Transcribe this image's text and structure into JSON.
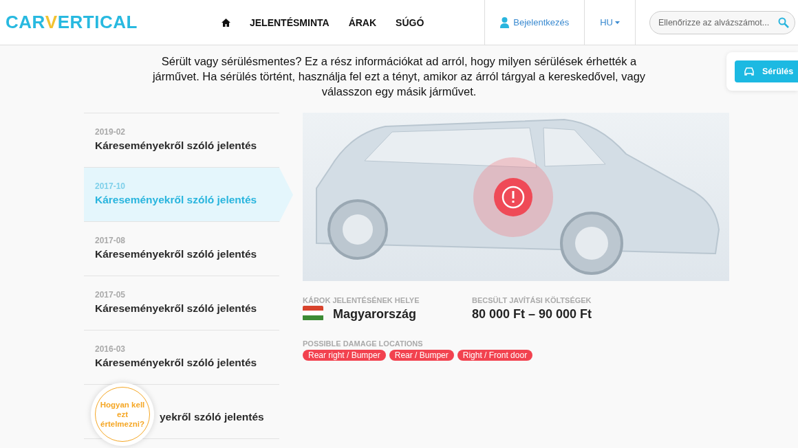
{
  "header": {
    "logo": {
      "part1": "CAR",
      "part2": "V",
      "part3": "ERTICAL"
    },
    "nav": [
      "JELENTÉSMINTA",
      "ÁRAK",
      "SÚGÓ"
    ],
    "login": "Bejelentkezés",
    "language": "HU",
    "search": {
      "placeholder": "Ellenőrizze az alvázszámot..."
    }
  },
  "side_tab": {
    "label": "Sérülés",
    "selected": true
  },
  "intro": "Sérült vagy sérülésmentes? Ez a rész információkat ad arról, hogy milyen sérülések érhették a járművet. Ha sérülés történt, használja fel ezt a tényt, amikor az árról tárgyal a kereskedővel, vagy válasszon egy másik járművet.",
  "reports": [
    {
      "date": "2019-02",
      "title": "Káreseményekről szóló jelentés",
      "selected": false
    },
    {
      "date": "2017-10",
      "title": "Káreseményekről szóló jelentés",
      "selected": true
    },
    {
      "date": "2017-08",
      "title": "Káreseményekről szóló jelentés",
      "selected": false
    },
    {
      "date": "2017-05",
      "title": "Káreseményekről szóló jelentés",
      "selected": false
    },
    {
      "date": "2016-03",
      "title": "Káreseményekről szóló jelentés",
      "selected": false
    },
    {
      "title": "yekről szóló jelentés",
      "selected": false
    }
  ],
  "help_bubble": "Hogyan kell ezt értelmezni?",
  "details": {
    "location_label": "KÁROK JELENTÉSÉNEK HELYE",
    "location": "Magyarország",
    "cost_label": "BECSÜLT JAVÍTÁSI KÖLTSÉGEK",
    "cost": "80 000 Ft – 90 000 Ft",
    "damage_label": "POSSIBLE DAMAGE LOCATIONS",
    "damage_tags": [
      "Rear right / Bumper",
      "Rear / Bumper",
      "Right / Front door"
    ]
  }
}
